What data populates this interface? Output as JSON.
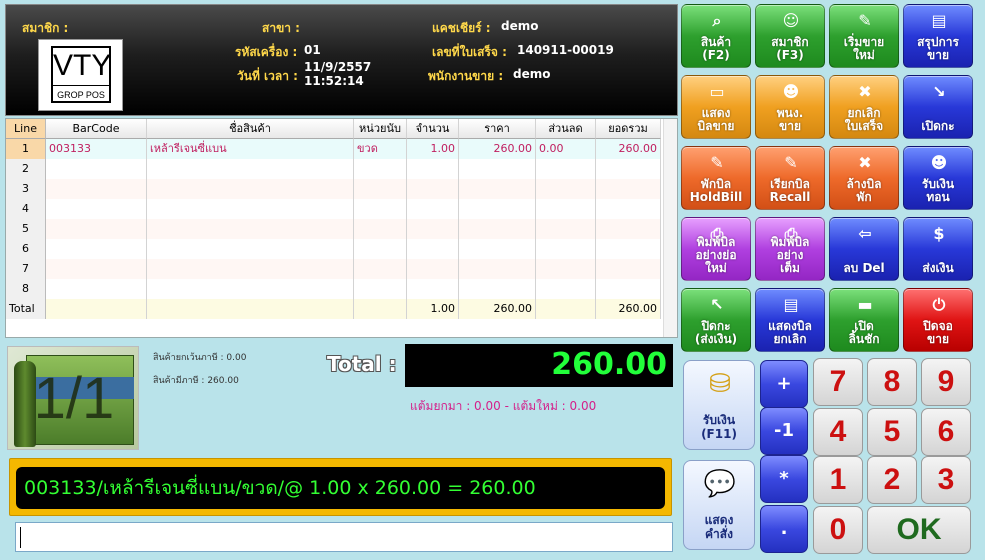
{
  "header": {
    "member_label": "สมาชิก :",
    "branch_label": "สาขา :",
    "cashier_label": "แคชเชียร์ :",
    "cashier_value": "demo",
    "machine_label": "รหัสเครื่อง :",
    "machine_value": "01",
    "receipt_label": "เลขที่ใบเสร็จ :",
    "receipt_value": "140911-00019",
    "datetime_label": "วันที่ เวลา :",
    "date_value": "11/9/2557",
    "time_value": "11:52:14",
    "salesperson_label": "พนักงานขาย :",
    "salesperson_value": "demo",
    "logo_text": "VTY",
    "logo_subtext": "GROP POS"
  },
  "table": {
    "columns": [
      "Line",
      "BarCode",
      "ชื่อสินค้า",
      "หน่วยนับ",
      "จำนวน",
      "ราคา",
      "ส่วนลด",
      "ยอดรวม"
    ],
    "rows": [
      {
        "line": "1",
        "barcode": "003133",
        "name": "เหล้ารีเจนซี่แบน",
        "unit": "ขวด",
        "qty": "1.00",
        "price": "260.00",
        "discount": "0.00",
        "total": "260.00"
      },
      {
        "line": "2",
        "barcode": "",
        "name": "",
        "unit": "",
        "qty": "",
        "price": "",
        "discount": "",
        "total": ""
      },
      {
        "line": "3",
        "barcode": "",
        "name": "",
        "unit": "",
        "qty": "",
        "price": "",
        "discount": "",
        "total": ""
      },
      {
        "line": "4",
        "barcode": "",
        "name": "",
        "unit": "",
        "qty": "",
        "price": "",
        "discount": "",
        "total": ""
      },
      {
        "line": "5",
        "barcode": "",
        "name": "",
        "unit": "",
        "qty": "",
        "price": "",
        "discount": "",
        "total": ""
      },
      {
        "line": "6",
        "barcode": "",
        "name": "",
        "unit": "",
        "qty": "",
        "price": "",
        "discount": "",
        "total": ""
      },
      {
        "line": "7",
        "barcode": "",
        "name": "",
        "unit": "",
        "qty": "",
        "price": "",
        "discount": "",
        "total": ""
      },
      {
        "line": "8",
        "barcode": "",
        "name": "",
        "unit": "",
        "qty": "",
        "price": "",
        "discount": "",
        "total": ""
      }
    ],
    "total_row": {
      "label": "Total",
      "qty": "1.00",
      "price": "260.00",
      "total": "260.00"
    }
  },
  "summary": {
    "page_indicator": "1/1",
    "exempt_label": "สินค้ายกเว้นภาษี : 0.00",
    "taxed_label": "สินค้ามีภาษี : 260.00",
    "total_label": "Total :",
    "total_value": "260.00",
    "bill_info": "แต้มยกมา : 0.00 - แต้มใหม่ : 0.00",
    "scan_line": "003133/เหล้ารีเจนซี่แบน/ขวด/@ 1.00 x 260.00 = 260.00",
    "input_value": ""
  },
  "function_buttons": [
    {
      "label": "สินค้า\n(F2)",
      "icon": "search-icon",
      "glyph": "⌕",
      "color": "green"
    },
    {
      "label": "สมาชิก\n(F3)",
      "icon": "member-icon",
      "glyph": "☺",
      "color": "green"
    },
    {
      "label": "เริ่มขาย\nใหม่",
      "icon": "new-sale-icon",
      "glyph": "✎",
      "color": "green"
    },
    {
      "label": "สรุปการ\nขาย",
      "icon": "summary-icon",
      "glyph": "▤",
      "color": "blue"
    },
    {
      "label": "แสดง\nบิลขาย",
      "icon": "bill-icon",
      "glyph": "▭",
      "color": "orange"
    },
    {
      "label": "พนง.\nขาย",
      "icon": "staff-icon",
      "glyph": "☻",
      "color": "orange"
    },
    {
      "label": "ยกเลิก\nใบเสร็จ",
      "icon": "cancel-icon",
      "glyph": "✖",
      "color": "orange"
    },
    {
      "label": "เปิดกะ",
      "icon": "open-shift-icon",
      "glyph": "↘",
      "color": "blue"
    },
    {
      "label": "พักบิล\nHoldBill",
      "icon": "hold-bill-icon",
      "glyph": "✎",
      "color": "red-o"
    },
    {
      "label": "เรียกบิล\nRecall",
      "icon": "recall-bill-icon",
      "glyph": "✎",
      "color": "red-o"
    },
    {
      "label": "ล้างบิล\nพัก",
      "icon": "clear-bill-icon",
      "glyph": "✖",
      "color": "red-o"
    },
    {
      "label": "รับเงิน\nทอน",
      "icon": "change-icon",
      "glyph": "☻",
      "color": "blue"
    },
    {
      "label": "พิมพ์บิล\nอย่างย่อ\nใหม่",
      "icon": "print-short-icon",
      "glyph": "⎙",
      "color": "purple"
    },
    {
      "label": "พิมพ์บิล\nอย่าง\nเต็ม",
      "icon": "print-full-icon",
      "glyph": "⎙",
      "color": "purple"
    },
    {
      "label": "ลบ  Del",
      "icon": "delete-icon",
      "glyph": "⇦",
      "color": "blue"
    },
    {
      "label": "ส่งเงิน",
      "icon": "money-bag-icon",
      "glyph": "$",
      "color": "blue"
    },
    {
      "label": "ปิดกะ\n(ส่งเงิน)",
      "icon": "close-shift-icon",
      "glyph": "↖",
      "color": "green"
    },
    {
      "label": "แสดงบิล\nยกเลิก",
      "icon": "cancelled-bill-icon",
      "glyph": "▤",
      "color": "blue"
    },
    {
      "label": "เปิด\nลิ้นชัก",
      "icon": "drawer-icon",
      "glyph": "▬",
      "color": "green"
    },
    {
      "label": "ปิดจอ\nขาย",
      "icon": "power-icon",
      "glyph": "⏻",
      "color": "red"
    }
  ],
  "keypad": {
    "receive_label": "รับเงิน\n(F11)",
    "show_command_label": "แสดง\nคำสั่ง",
    "plus": "+",
    "minus_one": "-1",
    "multiply": "*",
    "dot": ".",
    "digits": [
      "7",
      "8",
      "9",
      "4",
      "5",
      "6",
      "1",
      "2",
      "3",
      "0"
    ],
    "ok": "OK"
  }
}
